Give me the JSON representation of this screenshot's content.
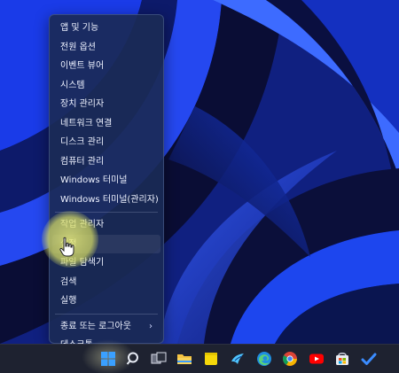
{
  "context_menu": {
    "items": [
      {
        "label": "앱 및 기능"
      },
      {
        "label": "전원 옵션"
      },
      {
        "label": "이벤트 뷰어"
      },
      {
        "label": "시스템"
      },
      {
        "label": "장치 관리자"
      },
      {
        "label": "네트워크 연결"
      },
      {
        "label": "디스크 관리"
      },
      {
        "label": "컴퓨터 관리"
      },
      {
        "label": "Windows 터미널"
      },
      {
        "label": "Windows 터미널(관리자)"
      },
      {
        "label": "작업 관리자"
      },
      {
        "label": "설정"
      },
      {
        "label": "파일 탐색기"
      },
      {
        "label": "검색"
      },
      {
        "label": "실행"
      },
      {
        "label": "종료 또는 로그아웃",
        "has_submenu": true
      },
      {
        "label": "데스크톱"
      }
    ],
    "submenu_glyph": "›",
    "hovered_item": "설정"
  },
  "taskbar": {
    "icons": [
      "start-icon",
      "search-icon",
      "task-view-icon",
      "file-explorer-icon",
      "sticky-notes-icon",
      "bird-app-icon",
      "edge-icon",
      "chrome-icon",
      "youtube-icon",
      "microsoft-store-icon",
      "todo-check-icon"
    ]
  },
  "colors": {
    "menu_bg": "#1a2a56",
    "highlight": "#e4e878",
    "wallpaper_blue": "#1a3de0",
    "taskbar_bg": "#1e2230"
  }
}
